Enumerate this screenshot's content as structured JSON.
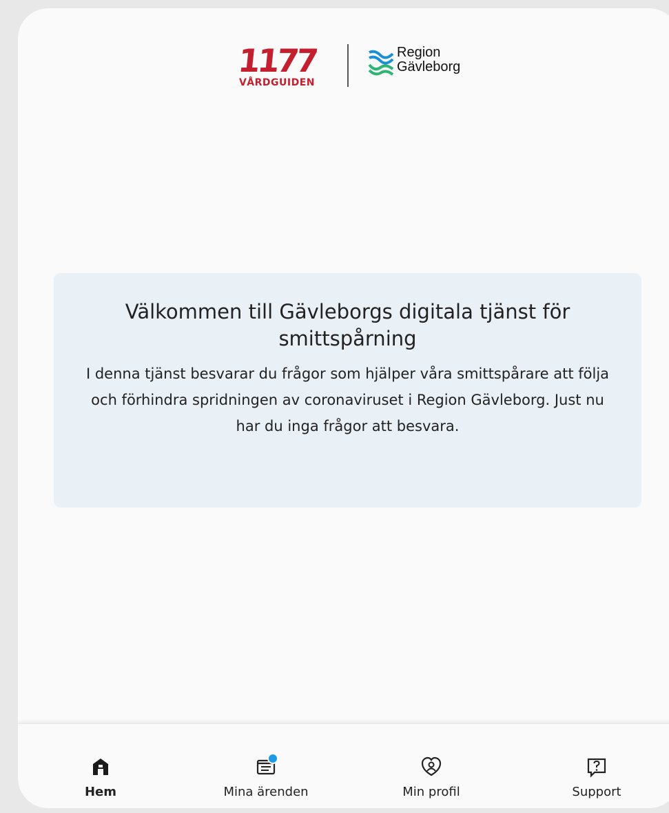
{
  "header": {
    "logo_1177_number": "1177",
    "logo_1177_text": "VÅRDGUIDEN",
    "region_logo_line1": "Region",
    "region_logo_line2": "Gävleborg"
  },
  "welcome": {
    "title": "Välkommen till Gävleborgs digitala tjänst för smittspårning",
    "body": "I denna tjänst besvarar du frågor som hjälper våra smittspårare att följa och förhindra spridningen av coronaviruset i Region Gävleborg. Just nu har du inga frågor att besvara."
  },
  "tabs": [
    {
      "label": "Hem",
      "icon": "home-icon",
      "active": true
    },
    {
      "label": "Mina ärenden",
      "icon": "cases-icon",
      "active": false,
      "badge": true
    },
    {
      "label": "Min profil",
      "icon": "profile-icon",
      "active": false
    },
    {
      "label": "Support",
      "icon": "support-icon",
      "active": false
    }
  ],
  "colors": {
    "brand_red": "#c41f2f",
    "card_background": "#e9f0f6",
    "badge_blue": "#1a9be6",
    "region_blue": "#1a8fd6",
    "region_green": "#2fb573"
  }
}
